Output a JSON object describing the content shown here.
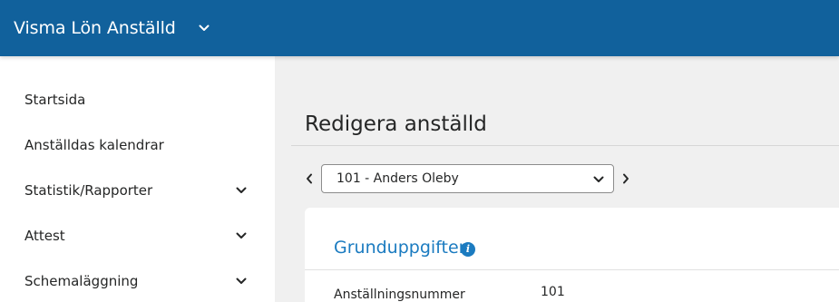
{
  "app": {
    "title": "Visma Lön Anställd",
    "icon": "chevron-down-icon"
  },
  "colors": {
    "header": "#11619c",
    "accent": "#1b7bc0",
    "background": "#f0f0f0"
  },
  "sidebar": {
    "items": [
      {
        "label": "Startsida",
        "expandable": false
      },
      {
        "label": "Anställdas kalendrar",
        "expandable": false
      },
      {
        "label": "Statistik/Rapporter",
        "expandable": true
      },
      {
        "label": "Attest",
        "expandable": true
      },
      {
        "label": "Schemaläggning",
        "expandable": true
      }
    ]
  },
  "main": {
    "title": "Redigera anställd",
    "employee_select": {
      "value": "101 - Anders Oleby"
    },
    "section": {
      "title": "Grunduppgifter",
      "info_icon": "info-icon",
      "fields": [
        {
          "label": "Anställningsnummer",
          "value": "101"
        }
      ]
    }
  }
}
